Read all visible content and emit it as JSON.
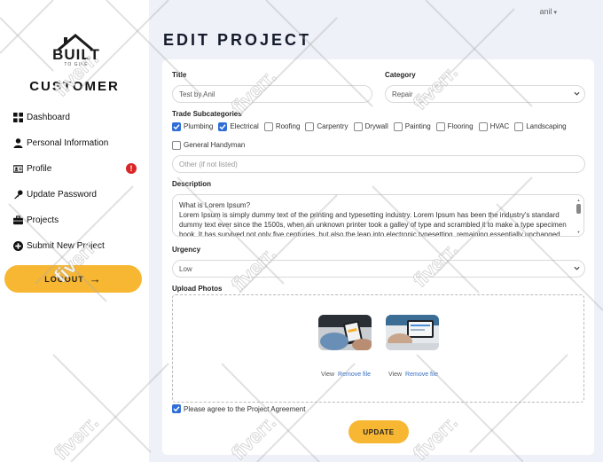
{
  "header": {
    "user_name": "anil",
    "caret": "▾"
  },
  "sidebar": {
    "logo_text": "BUILT",
    "logo_sub": "TO GIVE",
    "role": "CUSTOMER",
    "items": [
      {
        "label": "Dashboard",
        "icon": "dashboard-icon"
      },
      {
        "label": "Personal Information",
        "icon": "user-icon"
      },
      {
        "label": "Profile",
        "icon": "id-card-icon",
        "badge": "!"
      },
      {
        "label": "Update Password",
        "icon": "key-icon"
      },
      {
        "label": "Projects",
        "icon": "briefcase-icon"
      },
      {
        "label": "Submit New Project",
        "icon": "plus-circle-icon"
      }
    ],
    "logout_label": "LOGOUT",
    "logout_arrow": "→"
  },
  "page": {
    "title": "EDIT PROJECT"
  },
  "form": {
    "title_label": "Title",
    "title_value": "Test by Anil",
    "category_label": "Category",
    "category_value": "Repair",
    "subcategories_label": "Trade Subcategories",
    "subcategories": [
      {
        "label": "Plumbing",
        "checked": true
      },
      {
        "label": "Electrical",
        "checked": true
      },
      {
        "label": "Roofing",
        "checked": false
      },
      {
        "label": "Carpentry",
        "checked": false
      },
      {
        "label": "Drywall",
        "checked": false
      },
      {
        "label": "Painting",
        "checked": false
      },
      {
        "label": "Flooring",
        "checked": false
      },
      {
        "label": "HVAC",
        "checked": false
      },
      {
        "label": "Landscaping",
        "checked": false
      },
      {
        "label": "General Handyman",
        "checked": false
      }
    ],
    "other_placeholder": "Other (if not listed)",
    "description_label": "Description",
    "description_line1": "What is Lorem Ipsum?",
    "description_line2": "Lorem Ipsum is simply dummy text of the printing and typesetting industry. Lorem Ipsum has been the industry's standard dummy text ever since the 1500s, when an unknown printer took a galley of type and scrambled it to make a type specimen book. It has survived not only five centuries, but also the leap into electronic typesetting, remaining essentially unchanged.",
    "urgency_label": "Urgency",
    "urgency_value": "Low",
    "photos_label": "Upload Photos",
    "photos": [
      {
        "view": "View",
        "remove": "Remove file"
      },
      {
        "view": "View",
        "remove": "Remove file"
      }
    ],
    "agree_label": "Please agree to the Project Agreement",
    "agree_checked": true,
    "update_label": "UPDATE"
  },
  "watermark": "fiverr.",
  "colors": {
    "accent": "#f7b733",
    "check": "#2f6ed6",
    "alert": "#d92626",
    "link": "#3a6fc4"
  }
}
